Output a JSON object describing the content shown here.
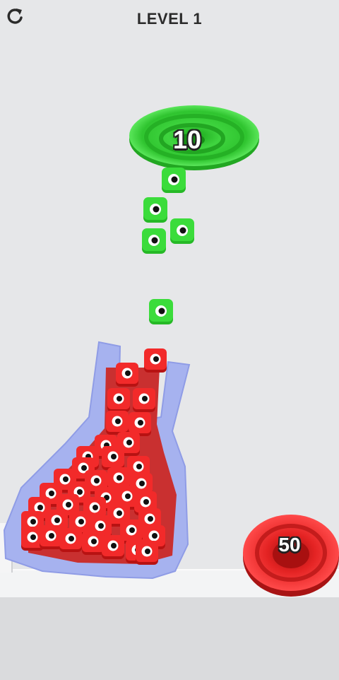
{
  "header": {
    "level_label": "LEVEL 1",
    "restart_icon": "restart-icon"
  },
  "portals": {
    "green": {
      "count": "10",
      "color": "#3dd63d"
    },
    "red": {
      "count": "50",
      "color": "#e52222"
    }
  },
  "colors": {
    "background": "#e6e7e9",
    "flask": "#a9b4ec",
    "green_block": "#2fd12f",
    "red_block": "#e51f1f"
  }
}
